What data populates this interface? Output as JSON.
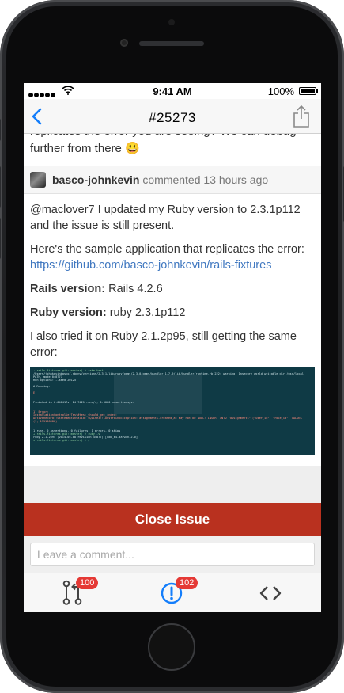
{
  "status_bar": {
    "time": "9:41 AM",
    "battery": "100%"
  },
  "nav": {
    "title": "#25273"
  },
  "previous_comment": {
    "text": "replicates the error you are seeing? We can debug further from there 😃"
  },
  "comment": {
    "author": "basco-johnkevin",
    "action": "commented",
    "time": "13 hours ago",
    "paragraph1": "@maclover7 I updated my Ruby version to 2.3.1p112 and the issue is still present.",
    "paragraph2": "Here's the sample application that replicates the error:",
    "link": "https://github.com/basco-johnkevin/rails-fixtures",
    "rails_label": "Rails version:",
    "rails_value": " Rails 4.2.6",
    "ruby_label": "Ruby version:",
    "ruby_value": " ruby 2.3.1p112",
    "paragraph5": "I also tried it on Ruby 2.1.2p95, still getting the same error:"
  },
  "actions": {
    "close_label": "Close Issue"
  },
  "composer": {
    "placeholder": "Leave a comment..."
  },
  "tabs": [
    {
      "icon": "pull-request-icon",
      "badge": "100"
    },
    {
      "icon": "issue-icon",
      "badge": "102"
    },
    {
      "icon": "code-icon"
    }
  ],
  "colors": {
    "accent": "#147efb",
    "close": "#b9311f",
    "badge": "#e53935",
    "link": "#4078c0"
  }
}
